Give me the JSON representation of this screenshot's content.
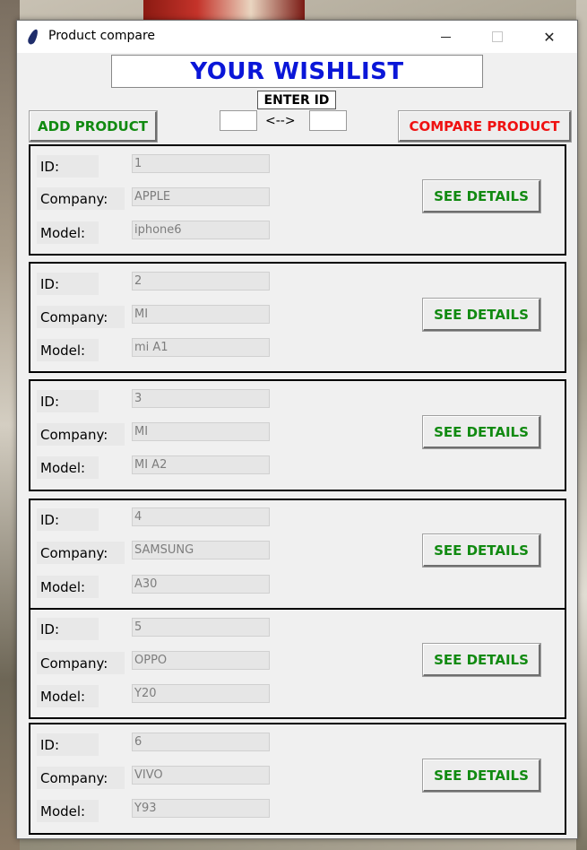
{
  "window": {
    "title": "Product compare",
    "icon": "feather-icon",
    "controls": {
      "minimize": "minimize-icon",
      "maximize": "maximize-icon",
      "close": "✕"
    }
  },
  "header": {
    "heading": "YOUR WISHLIST",
    "enter_id_label": "ENTER ID",
    "compare_arrow": "<-->",
    "id_input_left": "",
    "id_input_right": ""
  },
  "toolbar": {
    "add_label": "ADD PRODUCT",
    "compare_label": "COMPARE PRODUCT"
  },
  "labels": {
    "id": "ID:",
    "company": "Company:",
    "model": "Model:",
    "details": "SEE DETAILS"
  },
  "colors": {
    "heading": "#0a16d8",
    "add": "#118a11",
    "compare": "#ef1111",
    "details": "#118a11"
  },
  "products": [
    {
      "id": "1",
      "company": "APPLE",
      "model": "iphone6"
    },
    {
      "id": "2",
      "company": "MI",
      "model": "mi A1"
    },
    {
      "id": "3",
      "company": "MI",
      "model": "MI A2"
    },
    {
      "id": "4",
      "company": "SAMSUNG",
      "model": "A30"
    },
    {
      "id": "5",
      "company": "OPPO",
      "model": "Y20"
    },
    {
      "id": "6",
      "company": "VIVO",
      "model": "Y93"
    }
  ]
}
